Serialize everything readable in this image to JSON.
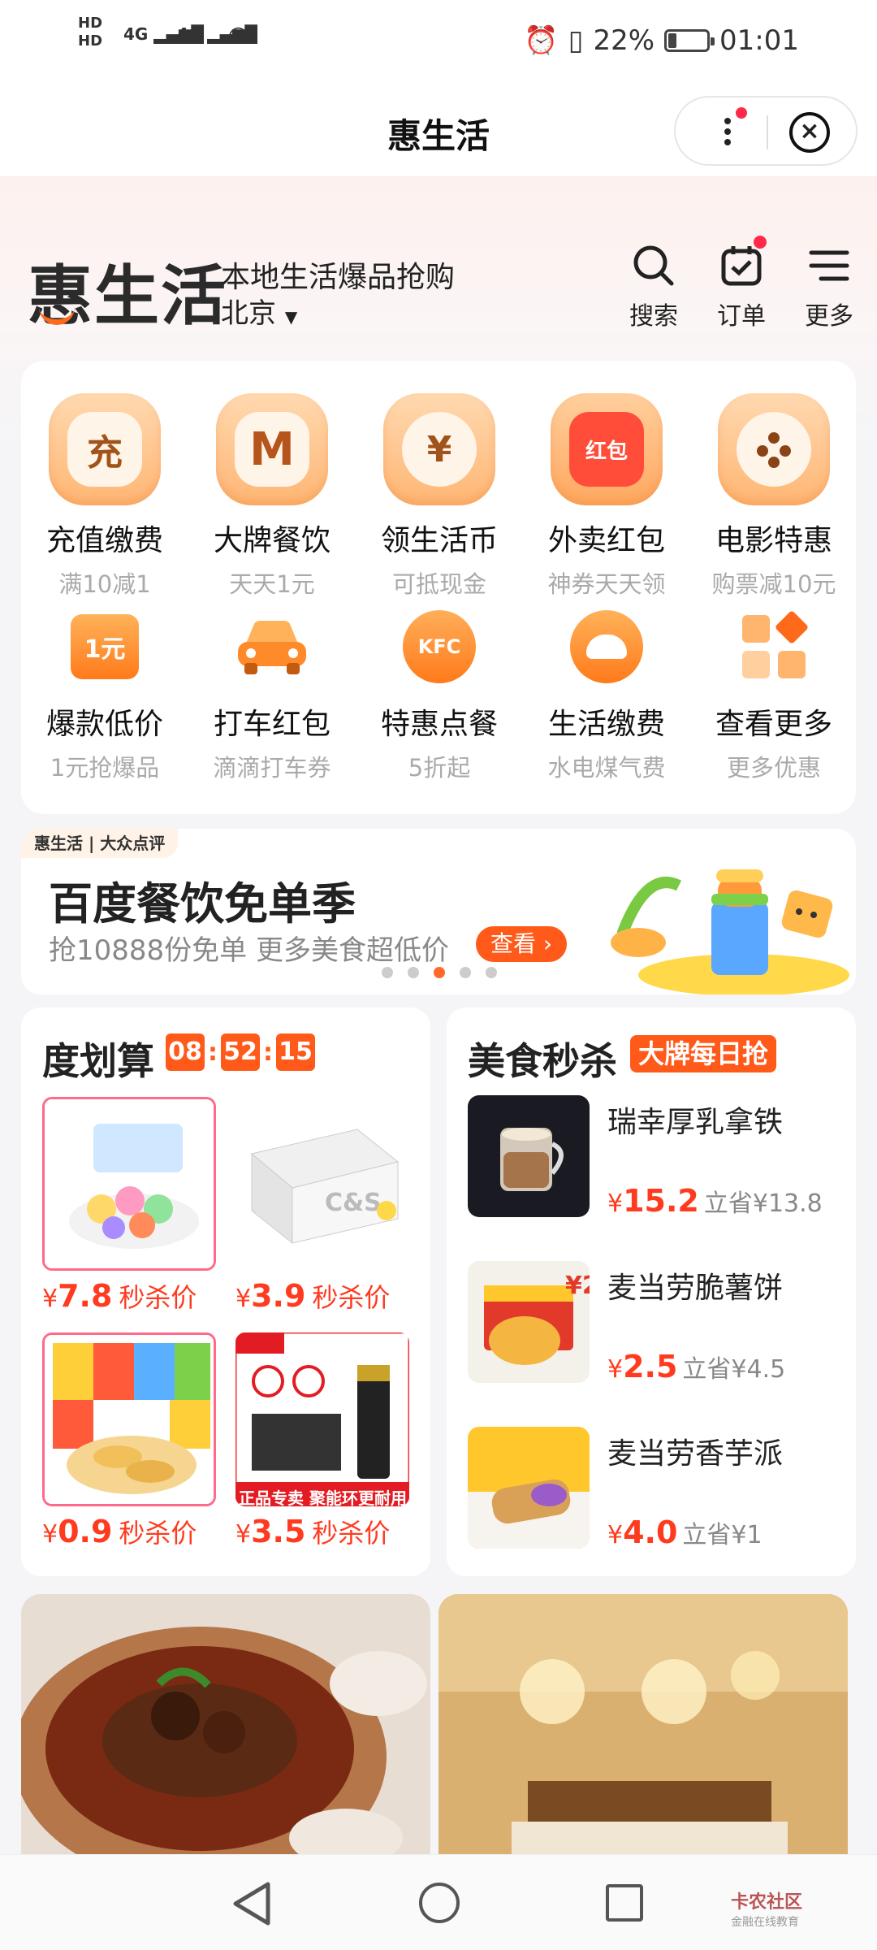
{
  "status_bar": {
    "left_line1": "HD",
    "left_line2": "HD",
    "signal1": "4G",
    "signal2": "4G",
    "battery_pct": "22%",
    "battery_level": 0.22,
    "time": "01:01"
  },
  "titlebar": {
    "title": "惠生活",
    "more_icon": "more-dots-icon",
    "close_icon": "close-circle-icon"
  },
  "header": {
    "logo": "惠生活",
    "slogan": "本地生活爆品抢购",
    "city": "北京",
    "actions": [
      {
        "label": "搜索",
        "icon": "search-icon"
      },
      {
        "label": "订单",
        "icon": "order-icon"
      },
      {
        "label": "更多",
        "icon": "menu-icon"
      }
    ]
  },
  "services": [
    {
      "label": "充值缴费",
      "sub": "满10减1",
      "glyph": "充"
    },
    {
      "label": "大牌餐饮",
      "sub": "天天1元",
      "glyph": "M"
    },
    {
      "label": "领生活币",
      "sub": "可抵现金",
      "glyph": "¥"
    },
    {
      "label": "外卖红包",
      "sub": "神券天天领",
      "glyph": "红包"
    },
    {
      "label": "电影特惠",
      "sub": "购票减10元",
      "glyph": "film"
    },
    {
      "label": "爆款低价",
      "sub": "1元抢爆品",
      "glyph": "1元"
    },
    {
      "label": "打车红包",
      "sub": "滴滴打车券",
      "glyph": "car"
    },
    {
      "label": "特惠点餐",
      "sub": "5折起",
      "glyph": "KFC"
    },
    {
      "label": "生活缴费",
      "sub": "水电煤气费",
      "glyph": "bill"
    },
    {
      "label": "查看更多",
      "sub": "更多优惠",
      "glyph": "grid"
    }
  ],
  "banner": {
    "tag": "惠生活 | 大众点评",
    "title": "百度餐饮免单季",
    "subtitle": "抢10888份免单 更多美食超低价",
    "button": "查看",
    "dots": 5,
    "active_dot": 2
  },
  "deal": {
    "title": "度划算",
    "timer": [
      "08",
      "52",
      "15"
    ],
    "products": [
      {
        "currency": "¥",
        "price": "7.8",
        "suffix": "秒杀价"
      },
      {
        "currency": "¥",
        "price": "3.9",
        "suffix": "秒杀价"
      },
      {
        "currency": "¥",
        "price": "0.9",
        "suffix": "秒杀价"
      },
      {
        "currency": "¥",
        "price": "3.5",
        "suffix": "秒杀价"
      }
    ],
    "battery_ad": "正品专卖 聚能环更耐用"
  },
  "food": {
    "title": "美食秒杀",
    "badge": "大牌每日抢",
    "items": [
      {
        "name": "瑞幸厚乳拿铁",
        "currency": "¥",
        "price": "15.2",
        "save": "立省¥13.8"
      },
      {
        "name": "麦当劳脆薯饼",
        "currency": "¥",
        "price": "2.5",
        "save": "立省¥4.5"
      },
      {
        "name": "麦当劳香芋派",
        "currency": "¥",
        "price": "4.0",
        "save": "立省¥1"
      }
    ]
  },
  "navbar": {
    "watermark": "卡农社区",
    "watermark_sub": "金融在线教育"
  }
}
